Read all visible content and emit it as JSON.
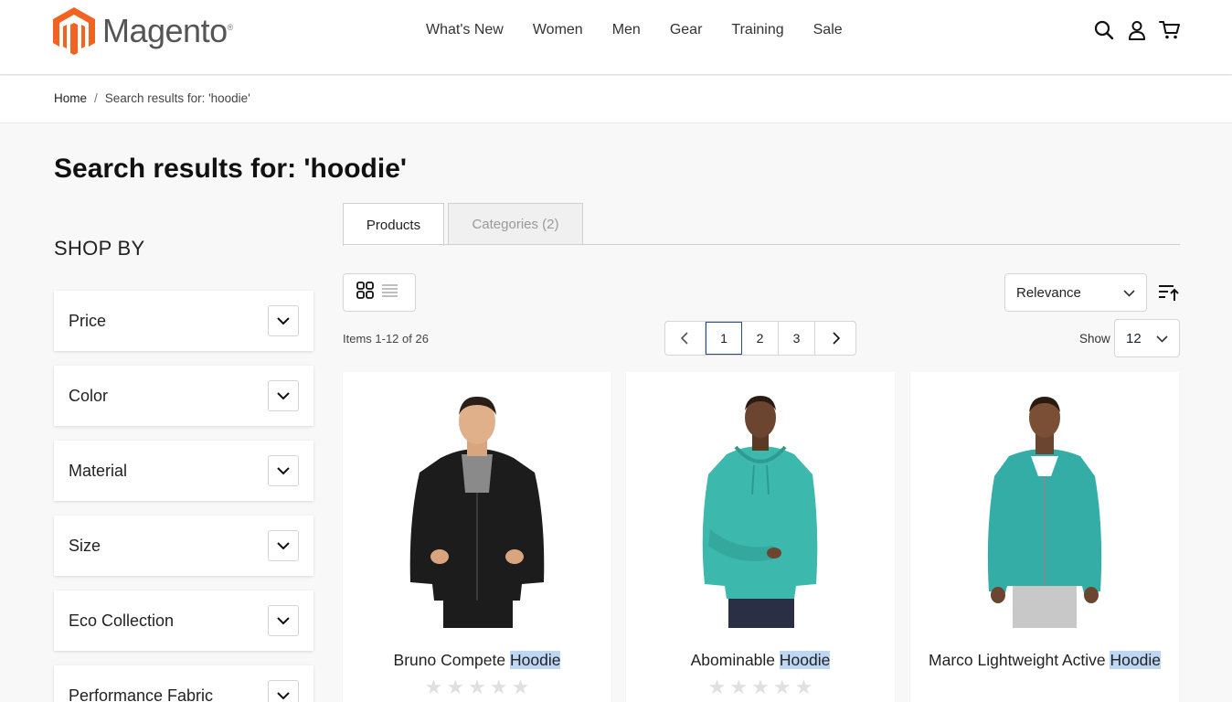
{
  "header": {
    "logo_text": "Magento",
    "logo_mark": "®",
    "nav": [
      "What's New",
      "Women",
      "Men",
      "Gear",
      "Training",
      "Sale"
    ],
    "icons": [
      "search-icon",
      "account-icon",
      "cart-icon"
    ]
  },
  "breadcrumb": {
    "home": "Home",
    "separator": "/",
    "current": "Search results for: 'hoodie'"
  },
  "page_title": "Search results for: 'hoodie'",
  "sidebar": {
    "heading": "SHOP BY",
    "filters": [
      "Price",
      "Color",
      "Material",
      "Size",
      "Eco Collection",
      "Performance Fabric"
    ]
  },
  "tabs": {
    "products": "Products",
    "categories": "Categories (2)"
  },
  "toolbar": {
    "sort_value": "Relevance",
    "items_text": "Items 1-12 of 26",
    "pages": [
      "1",
      "2",
      "3"
    ],
    "current_page": "1",
    "show_label": "Show",
    "limit_value": "12"
  },
  "products": [
    {
      "name_prefix": "Bruno Compete ",
      "name_highlight": "Hoodie",
      "rating": 0,
      "hoodie_color": "#1c1c1c",
      "pants_color": "#1c1c1c"
    },
    {
      "name_prefix": "Abominable ",
      "name_highlight": "Hoodie",
      "rating": 0,
      "hoodie_color": "#3cb8ad",
      "pants_color": "#2b2f45"
    },
    {
      "name_prefix": "Marco Lightweight Active ",
      "name_highlight": "Hoodie",
      "rating": 0,
      "hoodie_color": "#33ada6",
      "pants_color": "#c8c8c8"
    }
  ],
  "colors": {
    "brand_orange": "#f26322",
    "highlight": "#bdd7f4",
    "active_page_border": "#2a4b8d"
  }
}
